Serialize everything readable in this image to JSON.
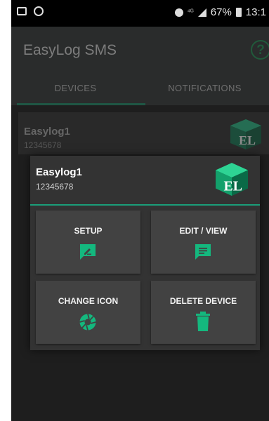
{
  "status_bar": {
    "signal_small": "⁴ᴳ",
    "battery": "67%",
    "time": "13:1"
  },
  "app": {
    "title": "EasyLog SMS",
    "help_icon": "?"
  },
  "tabs": [
    {
      "label": "DEVICES",
      "selected": true
    },
    {
      "label": "NOTIFICATIONS",
      "selected": false
    }
  ],
  "device": {
    "name": "Easylog1",
    "number": "12345678",
    "logo_text": "EL"
  },
  "dialog": {
    "name": "Easylog1",
    "number": "12345678",
    "actions": {
      "setup": "SETUP",
      "edit_view": "EDIT / VIEW",
      "change_icon": "CHANGE ICON",
      "delete_device": "DELETE DEVICE"
    }
  },
  "colors": {
    "accent": "#1a9e79",
    "icon_green": "#14b87e",
    "tile_bg": "#424242",
    "dialog_bg": "#333333"
  }
}
